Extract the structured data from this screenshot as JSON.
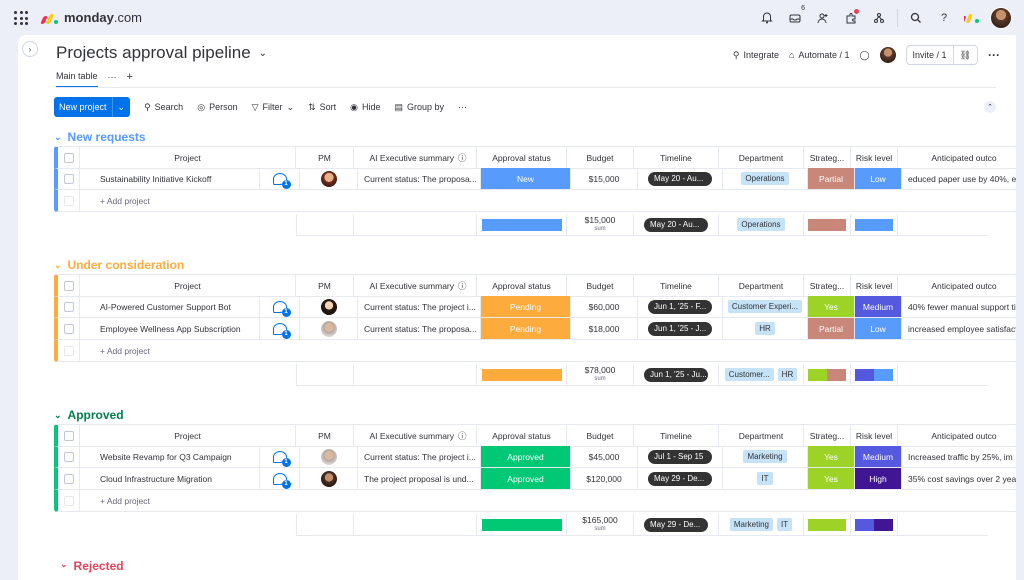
{
  "topbar": {
    "brand": "monday",
    "brand_suffix": ".com",
    "inbox_count": "6",
    "colors": {
      "notif_dot": "#e2445c"
    }
  },
  "board": {
    "title": "Projects approval pipeline",
    "integrate": "Integrate",
    "automate": "Automate / 1",
    "invite": "Invite / 1"
  },
  "tabs": {
    "main": "Main table",
    "more": "···",
    "add": "+"
  },
  "toolbar": {
    "new": "New project",
    "search": "Search",
    "person": "Person",
    "filter": "Filter",
    "sort": "Sort",
    "hide": "Hide",
    "groupby": "Group by",
    "more": "···"
  },
  "columns": {
    "project": "Project",
    "pm": "PM",
    "ai": "AI Executive summary",
    "status": "Approval status",
    "budget": "Budget",
    "timeline": "Timeline",
    "department": "Department",
    "strategic": "Strateg...",
    "risk": "Risk level",
    "anticipated": "Anticipated outco"
  },
  "add_project": "+ Add project",
  "sum_label": "sum",
  "groups": [
    {
      "title": "New requests",
      "color": "#579bfc",
      "rows": [
        {
          "project": "Sustainability Initiative Kickoff",
          "ai": "Current status: The proposa...",
          "status": "New",
          "status_color": "#579bfc",
          "budget": "$15,000",
          "timeline": "May 20 - Au...",
          "dept": "Operations",
          "strategic": "Partial",
          "strategic_color": "#c9877a",
          "risk": "Low",
          "risk_color": "#579bfc",
          "anticipated": "educed paper use by 40%, e"
        }
      ],
      "summary": {
        "budget": "$15,000",
        "timeline": "May 20 - Au...",
        "dept": [
          "Operations"
        ]
      }
    },
    {
      "title": "Under consideration",
      "color": "#fdab3d",
      "rows": [
        {
          "project": "AI-Powered Customer Support Bot",
          "ai": "Current status: The project i...",
          "status": "Pending",
          "status_color": "#fdab3d",
          "budget": "$60,000",
          "timeline": "Jun 1, '25 - F...",
          "dept": "Customer Experi...",
          "strategic": "Yes",
          "strategic_color": "#9cd326",
          "risk": "Medium",
          "risk_color": "#5559df",
          "anticipated": "40% fewer manual support ti"
        },
        {
          "project": "Employee Wellness App Subscription",
          "ai": "Current status: The proposa...",
          "status": "Pending",
          "status_color": "#fdab3d",
          "budget": "$18,000",
          "timeline": "Jun 1, '25 - J...",
          "dept": "HR",
          "strategic": "Partial",
          "strategic_color": "#c9877a",
          "risk": "Low",
          "risk_color": "#579bfc",
          "anticipated": "increased employee satisfact"
        }
      ],
      "summary": {
        "budget": "$78,000",
        "timeline": "Jun 1, '25 - Ju...",
        "dept": [
          "Customer...",
          "HR"
        ]
      }
    },
    {
      "title": "Approved",
      "color": "#00c875",
      "rows": [
        {
          "project": "Website Revamp for Q3 Campaign",
          "ai": "Current status: The project i...",
          "status": "Approved",
          "status_color": "#00c875",
          "budget": "$45,000",
          "timeline": "Jul 1 - Sep 15",
          "dept": "Marketing",
          "strategic": "Yes",
          "strategic_color": "#9cd326",
          "risk": "Medium",
          "risk_color": "#5559df",
          "anticipated": "Increased traffic by 25%, im"
        },
        {
          "project": "Cloud Infrastructure Migration",
          "ai": "The project proposal is und...",
          "status": "Approved",
          "status_color": "#00c875",
          "budget": "$120,000",
          "timeline": "May 29 - De...",
          "dept": "IT",
          "strategic": "Yes",
          "strategic_color": "#9cd326",
          "risk": "High",
          "risk_color": "#401694",
          "anticipated": "35% cost savings over 2 year"
        }
      ],
      "summary": {
        "budget": "$165,000",
        "timeline": "May 29 - De...",
        "dept": [
          "Marketing",
          "IT"
        ]
      }
    }
  ],
  "rejected": "Rejected",
  "approved_title_color": "#037f4c"
}
